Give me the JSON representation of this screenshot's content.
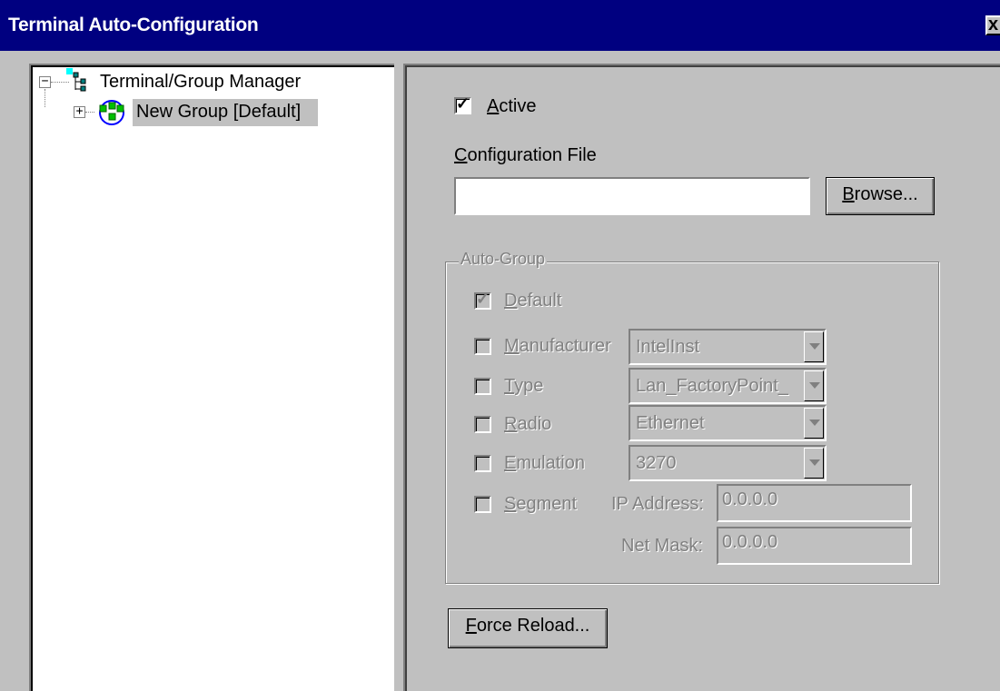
{
  "window": {
    "title": "Terminal Auto-Configuration",
    "close_glyph": "x"
  },
  "tree": {
    "root": {
      "label": "Terminal/Group Manager",
      "expander": "−",
      "icon": "tree-hierarchy-icon"
    },
    "child": {
      "label": "New Group [Default]",
      "expander": "+",
      "icon": "group-network-icon",
      "selected": true
    }
  },
  "panel": {
    "active": {
      "label_pre": "",
      "label_u": "A",
      "label_post": "ctive",
      "checked": true
    },
    "config_file": {
      "label_u": "C",
      "label_post": "onfiguration File",
      "value": ""
    },
    "browse_button": {
      "label_u": "B",
      "label_post": "rowse..."
    },
    "auto_group": {
      "title": "Auto-Group",
      "default": {
        "label_u": "D",
        "label_post": "efault",
        "checked": true
      },
      "rows": [
        {
          "label_u": "M",
          "label_post": "anufacturer",
          "value": "IntelInst",
          "checked": false
        },
        {
          "label_u": "T",
          "label_post": "ype",
          "value": "Lan_FactoryPoint_",
          "checked": false
        },
        {
          "label_u": "R",
          "label_post": "adio",
          "value": "Ethernet",
          "checked": false
        },
        {
          "label_u": "E",
          "label_post": "mulation",
          "value": "3270",
          "checked": false
        }
      ],
      "segment": {
        "label_u": "S",
        "label_post": "egment",
        "checked": false
      },
      "ip_address": {
        "label": "IP Address:",
        "value": "0.0.0.0"
      },
      "net_mask": {
        "label": "Net Mask:",
        "value": "0.0.0.0"
      }
    },
    "force_reload_button": {
      "label_u": "F",
      "label_post": "orce Reload..."
    }
  },
  "colors": {
    "titlebar": "#000080",
    "face": "#c0c0c0",
    "disabled_text": "#808080"
  }
}
